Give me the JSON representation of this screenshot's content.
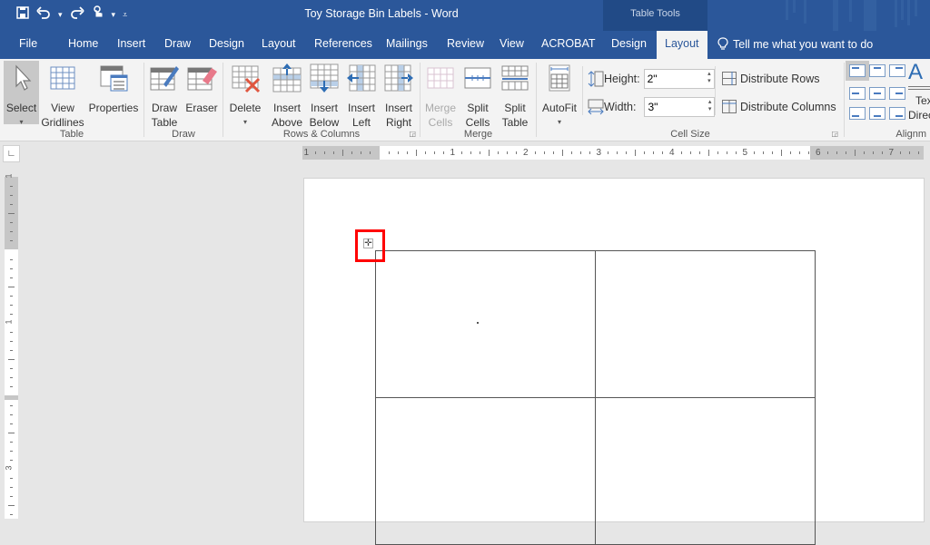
{
  "window": {
    "title": "Toy Storage Bin Labels - Word",
    "context_group": "Table Tools"
  },
  "quick_access": {
    "icons": [
      "save-icon",
      "undo-icon",
      "redo-icon",
      "touch-mode-icon",
      "customize-icon"
    ]
  },
  "tabs": [
    {
      "label": "File"
    },
    {
      "label": "Home"
    },
    {
      "label": "Insert"
    },
    {
      "label": "Draw"
    },
    {
      "label": "Design"
    },
    {
      "label": "Layout"
    },
    {
      "label": "References"
    },
    {
      "label": "Mailings"
    },
    {
      "label": "Review"
    },
    {
      "label": "View"
    },
    {
      "label": "ACROBAT"
    },
    {
      "label": "Design"
    },
    {
      "label": "Layout",
      "active": true
    }
  ],
  "tell_me": "Tell me what you want to do",
  "ribbon": {
    "table": {
      "label": "Table",
      "select": "Select",
      "view_gridlines_1": "View",
      "view_gridlines_2": "Gridlines",
      "properties": "Properties"
    },
    "draw": {
      "label": "Draw",
      "draw_table_1": "Draw",
      "draw_table_2": "Table",
      "eraser": "Eraser"
    },
    "rows_columns": {
      "label": "Rows & Columns",
      "delete": "Delete",
      "insert": "Insert",
      "above": "Above",
      "below": "Below",
      "left": "Left",
      "right": "Right"
    },
    "merge": {
      "label": "Merge",
      "merge_1": "Merge",
      "merge_2": "Cells",
      "split_cells_1": "Split",
      "split_cells_2": "Cells",
      "split_table_1": "Split",
      "split_table_2": "Table"
    },
    "cell_size": {
      "label": "Cell Size",
      "autofit": "AutoFit",
      "height_label": "Height:",
      "height_value": "2\"",
      "width_label": "Width:",
      "width_value": "3\"",
      "distribute_rows": "Distribute Rows",
      "distribute_columns": "Distribute Columns"
    },
    "alignment": {
      "label": "Alignm",
      "text_direction_1": "Tex",
      "text_direction_2": "Direc"
    }
  },
  "ruler": {
    "horizontal_numbers": [
      "1",
      "1",
      "2",
      "3",
      "4",
      "5",
      "6",
      "7"
    ],
    "vertical_numbers": [
      "1",
      "1",
      "3"
    ]
  },
  "document": {
    "table": {
      "rows": 2,
      "cols": 2,
      "cells": [
        [
          "",
          ""
        ],
        [
          "",
          ""
        ]
      ]
    }
  },
  "colors": {
    "accent": "#2b579a",
    "context_tab": "#214a86",
    "highlight": "#ff0000"
  }
}
